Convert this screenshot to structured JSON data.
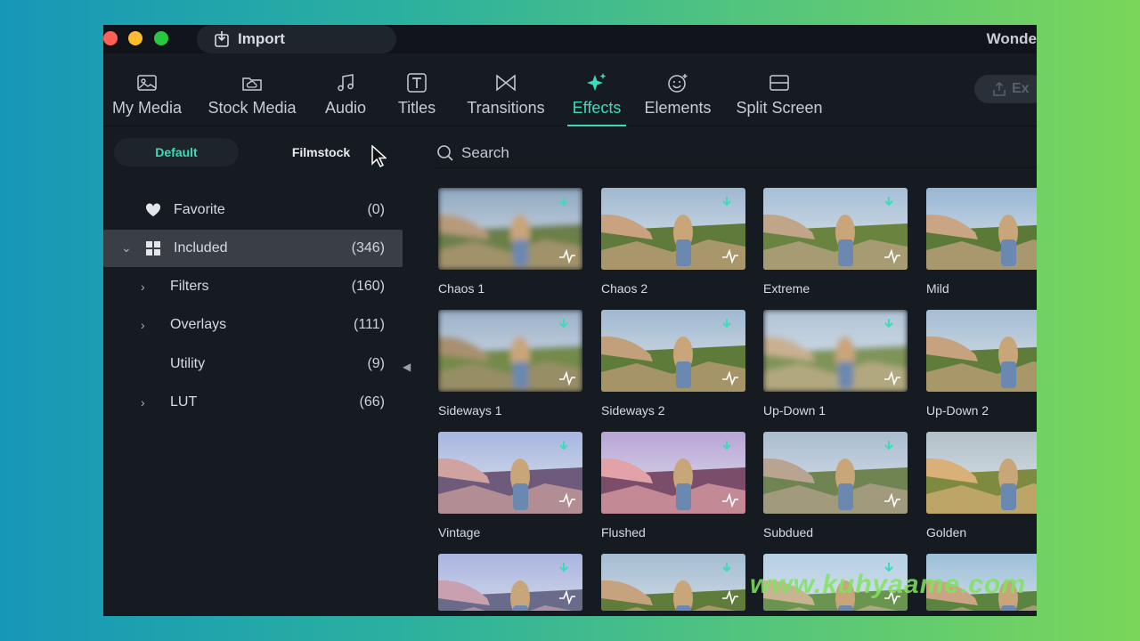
{
  "titlebar": {
    "import_label": "Import",
    "brand_text": "Wonde",
    "traffic_lights": {
      "close": "#ff5f57",
      "minimize": "#febc2e",
      "zoom": "#28c840"
    }
  },
  "tabs": [
    {
      "label": "My Media",
      "icon": "image-icon"
    },
    {
      "label": "Stock Media",
      "icon": "cloud-folder-icon"
    },
    {
      "label": "Audio",
      "icon": "music-note-icon"
    },
    {
      "label": "Titles",
      "icon": "text-t-icon"
    },
    {
      "label": "Transitions",
      "icon": "bowtie-icon"
    },
    {
      "label": "Effects",
      "icon": "sparkle-icon",
      "active": true
    },
    {
      "label": "Elements",
      "icon": "smiley-icon"
    },
    {
      "label": "Split Screen",
      "icon": "split-screen-icon"
    }
  ],
  "export_label": "Ex",
  "sidebar": {
    "segment_default": "Default",
    "segment_filmstock": "Filmstock",
    "categories": [
      {
        "label": "Favorite",
        "count": "(0)",
        "icon": "heart-icon"
      },
      {
        "label": "Included",
        "count": "(346)",
        "icon": "grid-icon",
        "selected": true,
        "expanded": true
      },
      {
        "label": "Filters",
        "count": "(160)"
      },
      {
        "label": "Overlays",
        "count": "(111)"
      },
      {
        "label": "Utility",
        "count": "(9)"
      },
      {
        "label": "LUT",
        "count": "(66)"
      }
    ]
  },
  "search": {
    "placeholder": "Search"
  },
  "effects": [
    {
      "name": "Chaos 1"
    },
    {
      "name": "Chaos 2"
    },
    {
      "name": "Extreme"
    },
    {
      "name": "Mild"
    },
    {
      "name": "Sideways 1"
    },
    {
      "name": "Sideways 2"
    },
    {
      "name": "Up-Down 1"
    },
    {
      "name": "Up-Down 2"
    },
    {
      "name": "Vintage"
    },
    {
      "name": "Flushed"
    },
    {
      "name": "Subdued"
    },
    {
      "name": "Golden"
    },
    {
      "name": ""
    },
    {
      "name": ""
    },
    {
      "name": ""
    },
    {
      "name": ""
    }
  ],
  "watermark": "www.kuhyaame.com",
  "colors": {
    "accent": "#3ddbb8",
    "panel": "#161b22",
    "selected_row": "#3a3f46"
  }
}
